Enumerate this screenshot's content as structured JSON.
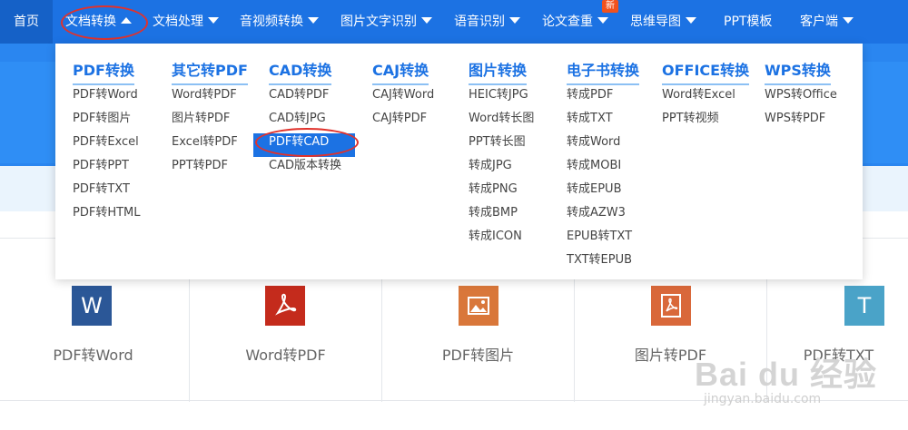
{
  "nav": {
    "home": "首页",
    "items": [
      {
        "label": "文档转换"
      },
      {
        "label": "文档处理"
      },
      {
        "label": "音视频转换"
      },
      {
        "label": "图片文字识别"
      },
      {
        "label": "语音识别"
      },
      {
        "label": "论文查重"
      },
      {
        "label": "思维导图"
      },
      {
        "label": "PPT模板"
      },
      {
        "label": "客户端"
      }
    ],
    "new_badge": "新",
    "open_item": "文档转换"
  },
  "dropdown": {
    "columns": [
      {
        "title": "PDF转换",
        "items": [
          "PDF转Word",
          "PDF转图片",
          "PDF转Excel",
          "PDF转PPT",
          "PDF转TXT",
          "PDF转HTML"
        ]
      },
      {
        "title": "其它转PDF",
        "items": [
          "Word转PDF",
          "图片转PDF",
          "Excel转PDF",
          "PPT转PDF"
        ]
      },
      {
        "title": "CAD转换",
        "items": [
          "CAD转PDF",
          "CAD转JPG",
          "PDF转CAD",
          "CAD版本转换"
        ]
      },
      {
        "title": "CAJ转换",
        "items": [
          "CAJ转Word",
          "CAJ转PDF"
        ]
      },
      {
        "title": "图片转换",
        "items": [
          "HEIC转JPG",
          "Word转长图",
          "PPT转长图",
          "转成JPG",
          "转成PNG",
          "转成BMP",
          "转成ICON"
        ]
      },
      {
        "title": "电子书转换",
        "items": [
          "转成PDF",
          "转成TXT",
          "转成Word",
          "转成MOBI",
          "转成EPUB",
          "转成AZW3",
          "EPUB转TXT",
          "TXT转EPUB"
        ]
      },
      {
        "title": "OFFICE转换",
        "items": [
          "Word转Excel",
          "PPT转视频"
        ]
      },
      {
        "title": "WPS转换",
        "items": [
          "WPS转Office",
          "WPS转PDF"
        ]
      }
    ],
    "selected_item": "PDF转CAD"
  },
  "cards": [
    {
      "label": "PDF转Word",
      "icon": "word-doc-icon",
      "icon_char": "W",
      "color": "#2b5797"
    },
    {
      "label": "Word转PDF",
      "icon": "pdf-acrobat-icon",
      "icon_char": "",
      "color": "#c42b1c"
    },
    {
      "label": "PDF转图片",
      "icon": "image-icon",
      "icon_char": "",
      "color": "#d9773a"
    },
    {
      "label": "图片转PDF",
      "icon": "pdf-file-icon",
      "icon_char": "",
      "color": "#d9683a"
    },
    {
      "label": "PDF转TXT",
      "icon": "txt-file-icon",
      "icon_char": "T",
      "color": "#4aa3c8"
    }
  ],
  "watermark": {
    "logo": "Bai du 经验",
    "url": "jingyan.baidu.com"
  },
  "colors": {
    "nav_bg": "#1c72e3",
    "accent": "#1c72e3",
    "annotation": "#e0322c",
    "badge": "#f0521e"
  }
}
